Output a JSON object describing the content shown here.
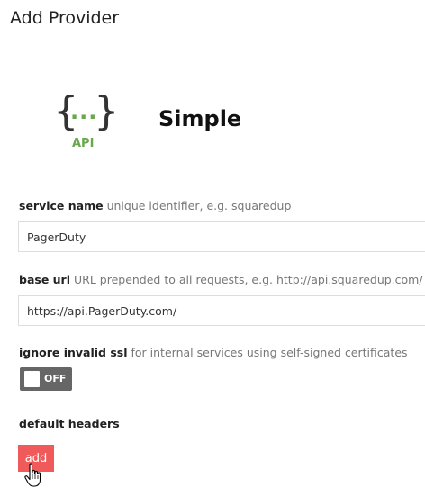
{
  "page": {
    "title": "Add Provider"
  },
  "provider": {
    "logo": {
      "left_bracket": "{",
      "dots": "...",
      "right_bracket": "}",
      "label": "API",
      "icon": "api-icon",
      "accent_color": "#6aa84f"
    },
    "name": "Simple"
  },
  "form": {
    "service_name": {
      "label": "service name",
      "hint": "unique identifier, e.g. squaredup",
      "value": "PagerDuty"
    },
    "base_url": {
      "label": "base url",
      "hint": "URL prepended to all requests, e.g. http://api.squaredup.com/",
      "value": "https://api.PagerDuty.com/"
    },
    "ignore_invalid_ssl": {
      "label": "ignore invalid ssl",
      "hint": "for internal services using self-signed certificates",
      "state": "OFF"
    },
    "default_headers": {
      "label": "default headers",
      "add_label": "add",
      "add_color": "#f05a5a"
    }
  },
  "cursor": {
    "icon": "hand-pointer-icon"
  }
}
